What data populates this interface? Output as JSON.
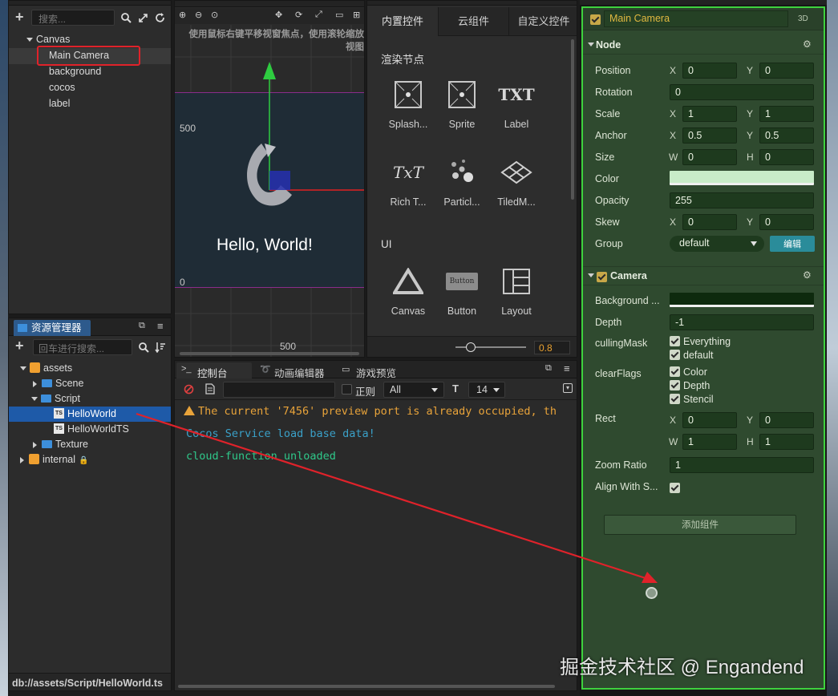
{
  "hierarchy": {
    "search_placeholder": "搜索...",
    "items": [
      "Canvas",
      "Main Camera",
      "background",
      "cocos",
      "label"
    ]
  },
  "assets": {
    "tab_label": "资源管理器",
    "search_placeholder": "回车进行搜索...",
    "items": [
      "assets",
      "Scene",
      "Script",
      "HelloWorld",
      "HelloWorldTS",
      "Texture",
      "internal"
    ],
    "status_path": "db://assets/Script/HelloWorld.ts"
  },
  "scene": {
    "hint": "使用鼠标右键平移视窗焦点，使用滚轮缩放",
    "hint2": "视图",
    "label_500_y": "500",
    "label_0_y": "0",
    "label_500_x": "500",
    "hello_text": "Hello, World!"
  },
  "widgets": {
    "tabs": [
      "内置控件",
      "云组件",
      "自定义控件"
    ],
    "section_render": "渲染节点",
    "render_items": [
      "Splash...",
      "Sprite",
      "Label",
      "Rich T...",
      "Particl...",
      "TiledM..."
    ],
    "label_icon_text": "TXT",
    "richtext_icon_text": "TxT",
    "button_icon_text": "Button",
    "section_ui": "UI",
    "ui_items": [
      "Canvas",
      "Button",
      "Layout"
    ],
    "zoom_value": "0.8"
  },
  "console": {
    "tabs": [
      "控制台",
      "动画编辑器",
      "游戏预览"
    ],
    "regex_label": "正则",
    "filter_value": "All",
    "font_size_value": "14",
    "logs": [
      {
        "text": "The current '7456' preview port is already occupied, th",
        "color": "#e8a33a"
      },
      {
        "text": "Cocos Service load base data!",
        "color": "#3aa0c8"
      },
      {
        "text": "cloud-function unloaded",
        "color": "#2fc88a"
      }
    ]
  },
  "inspector": {
    "node_name": "Main Camera",
    "badge_3d": "3D",
    "node_section": "Node",
    "camera_section": "Camera",
    "labels": {
      "position": "Position",
      "rotation": "Rotation",
      "scale": "Scale",
      "anchor": "Anchor",
      "size": "Size",
      "color": "Color",
      "opacity": "Opacity",
      "skew": "Skew",
      "group": "Group",
      "background": "Background ...",
      "depth": "Depth",
      "culling": "cullingMask",
      "clearflags": "clearFlags",
      "rect": "Rect",
      "zoom": "Zoom Ratio",
      "align": "Align With S..."
    },
    "axes": {
      "x": "X",
      "y": "Y",
      "w": "W",
      "h": "H"
    },
    "values": {
      "pos_x": "0",
      "pos_y": "0",
      "rotation": "0",
      "scale_x": "1",
      "scale_y": "1",
      "anchor_x": "0.5",
      "anchor_y": "0.5",
      "size_w": "0",
      "size_h": "0",
      "opacity": "255",
      "skew_x": "0",
      "skew_y": "0",
      "group": "default",
      "depth": "-1",
      "rect_x": "0",
      "rect_y": "0",
      "rect_w": "1",
      "rect_h": "1",
      "zoom": "1"
    },
    "group_edit": "编辑",
    "culling_options": [
      "Everything",
      "default"
    ],
    "clearflag_options": [
      "Color",
      "Depth",
      "Stencil"
    ],
    "add_component": "添加组件",
    "colors": {
      "node_color": "#c8ecc8",
      "background_color": "#0e2a0e"
    }
  },
  "watermark": "掘金技术社区 @ Engandend"
}
